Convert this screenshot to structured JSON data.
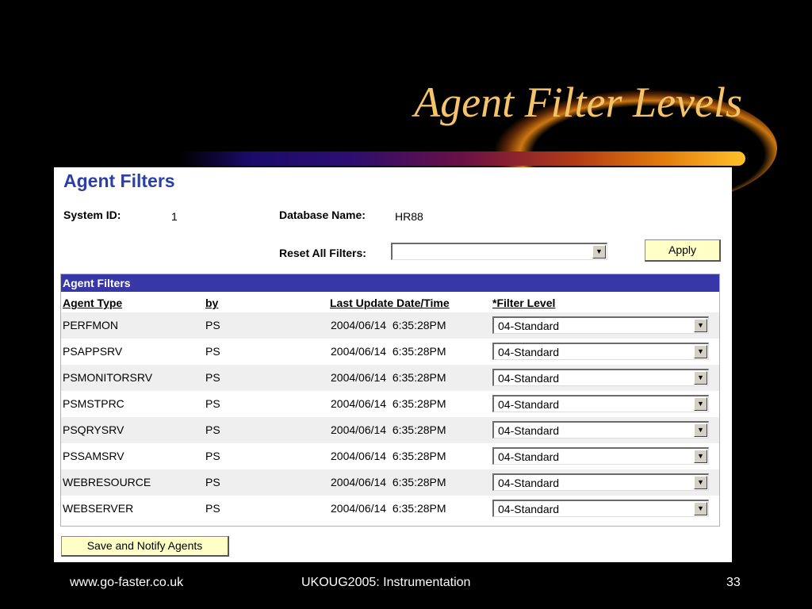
{
  "slide": {
    "title": "Agent Filter Levels",
    "footer_left": "www.go-faster.co.uk",
    "footer_center": "UKOUG2005: Instrumentation",
    "footer_right": "33"
  },
  "panel": {
    "heading": "Agent Filters",
    "system_id_label": "System ID:",
    "system_id_value": "1",
    "database_name_label": "Database Name:",
    "database_name_value": "HR88",
    "reset_label": "Reset All Filters:",
    "reset_value": "",
    "apply_label": "Apply",
    "grid": {
      "title": "Agent Filters",
      "columns": [
        "Agent Type",
        "by",
        "Last Update Date/Time",
        "*Filter Level"
      ],
      "rows": [
        {
          "agent_type": "PERFMON",
          "by": "PS",
          "updated": "2004/06/14  6:35:28PM",
          "filter_level": "04-Standard"
        },
        {
          "agent_type": "PSAPPSRV",
          "by": "PS",
          "updated": "2004/06/14  6:35:28PM",
          "filter_level": "04-Standard"
        },
        {
          "agent_type": "PSMONITORSRV",
          "by": "PS",
          "updated": "2004/06/14  6:35:28PM",
          "filter_level": "04-Standard"
        },
        {
          "agent_type": "PSMSTPRC",
          "by": "PS",
          "updated": "2004/06/14  6:35:28PM",
          "filter_level": "04-Standard"
        },
        {
          "agent_type": "PSQRYSRV",
          "by": "PS",
          "updated": "2004/06/14  6:35:28PM",
          "filter_level": "04-Standard"
        },
        {
          "agent_type": "PSSAMSRV",
          "by": "PS",
          "updated": "2004/06/14  6:35:28PM",
          "filter_level": "04-Standard"
        },
        {
          "agent_type": "WEBRESOURCE",
          "by": "PS",
          "updated": "2004/06/14  6:35:28PM",
          "filter_level": "04-Standard"
        },
        {
          "agent_type": "WEBSERVER",
          "by": "PS",
          "updated": "2004/06/14  6:35:28PM",
          "filter_level": "04-Standard"
        }
      ]
    },
    "save_button_label": "Save and Notify Agents"
  },
  "colors": {
    "title": "#f5c46a",
    "heading": "#2b3fa8",
    "grid_header": "#3737a8",
    "button_bg": "#ffffc6"
  }
}
